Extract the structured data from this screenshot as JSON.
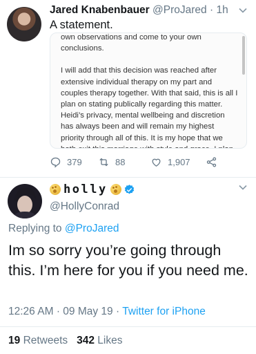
{
  "tweet1": {
    "name": "Jared Knabenbauer",
    "handle": "@ProJared",
    "time": "1h",
    "text": "A statement.",
    "statement_paragraphs": [
      "own observations and come to your own conclusions.",
      "I will add that this decision was reached after extensive individual therapy on my part and couples therapy together. With that said, this is all I plan on stating publically regarding this matter. Heidi’s privacy, mental wellbeing and discretion has always been and will remain my highest priority through all of this. It is my hope that we both exit this marriage with style and grace. I plan"
    ],
    "replies": "379",
    "retweets": "88",
    "likes": "1,907"
  },
  "tweet2": {
    "display_name": "holly",
    "handle": "@HollyConrad",
    "replying_prefix": "Replying to",
    "replying_handle": "@ProJared",
    "text": "Im so sorry you’re going through this. I’m here for you if you need me.",
    "time": "12:26 AM",
    "date": "09 May 19",
    "client": "Twitter for iPhone",
    "retweet_count": "19",
    "retweet_label": "Retweets",
    "like_count": "342",
    "like_label": "Likes"
  },
  "icons": {
    "reply": "reply-icon",
    "retweet": "retweet-icon",
    "like": "heart-icon",
    "share": "share-icon",
    "verified": "verified-badge-icon",
    "moon": "full-moon-face-emoji",
    "menu": "chevron-down-icon"
  },
  "colors": {
    "accent": "#1da1f2",
    "secondary_text": "#657786",
    "primary_text": "#14171a",
    "divider": "#e6ecf0"
  },
  "separators": {
    "dot": "·"
  }
}
